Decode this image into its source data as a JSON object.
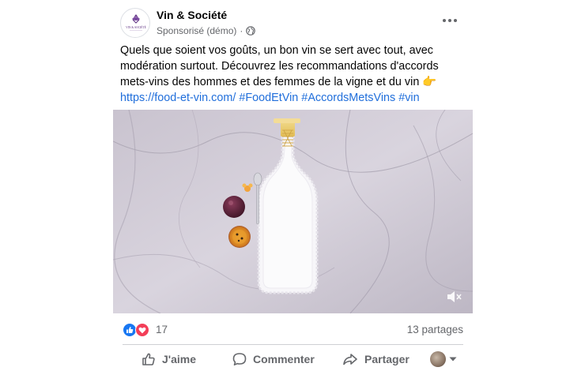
{
  "post": {
    "page_name": "Vin & Société",
    "sponsored_label": "Sponsorisé (démo)",
    "meta_separator": "·",
    "more_label": "•••",
    "message_text": "Quels que soient vos goûts, un bon vin se sert avec tout, avec modération surtout. Découvrez les recommandations d'accords mets-vins des hommes et des femmes de la vigne et du vin 👉 ",
    "message_link": "https://food-et-vin.com/",
    "hashtags": " #FoodEtVin #AccordsMetsVins #vin",
    "avatar_text": "VIN & SOCIÉTÉ"
  },
  "stats": {
    "reaction_count": "17",
    "reactions": [
      "like",
      "love"
    ],
    "shares": "13 partages"
  },
  "actions": {
    "like": "J'aime",
    "comment": "Commenter",
    "share": "Partager"
  },
  "colors": {
    "like_blue": "#1877f2",
    "love_red": "#f33e58",
    "link_blue": "#216fdb",
    "secondary_text": "#65676b"
  }
}
